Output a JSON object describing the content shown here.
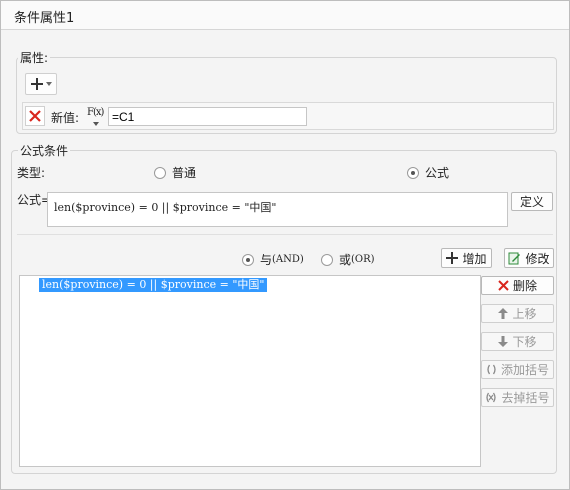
{
  "window": {
    "title": "条件属性1"
  },
  "attributes": {
    "legend": "属性:",
    "add_button_label": "+",
    "row": {
      "label": "新值:",
      "formula_icon_text": "F(x)",
      "value": "=C1"
    }
  },
  "formula_condition": {
    "legend": "公式条件",
    "type_label": "类型:",
    "type_options": [
      {
        "label": "普通",
        "selected": false
      },
      {
        "label": "公式",
        "selected": true
      }
    ],
    "formula_label": "公式=",
    "formula_value": "len($province) = 0 || $province = \"中国\"",
    "define_button": "定义",
    "logic_options": [
      {
        "label": "与",
        "code": "(AND)",
        "selected": true
      },
      {
        "label": "或",
        "code": "(OR)",
        "selected": false
      }
    ],
    "add_button": "增加",
    "modify_button": "修改",
    "list_items": [
      {
        "text": "len($province) = 0 || $province = \"中国\"",
        "selected": true
      }
    ],
    "side_buttons": {
      "delete": "删除",
      "move_up": "上移",
      "move_down": "下移",
      "add_parens": "添加括号",
      "remove_parens": "去掉括号"
    }
  },
  "colors": {
    "selection": "#3399ff",
    "delete_red": "#d9251c",
    "modify_green": "#2e8b3a"
  }
}
